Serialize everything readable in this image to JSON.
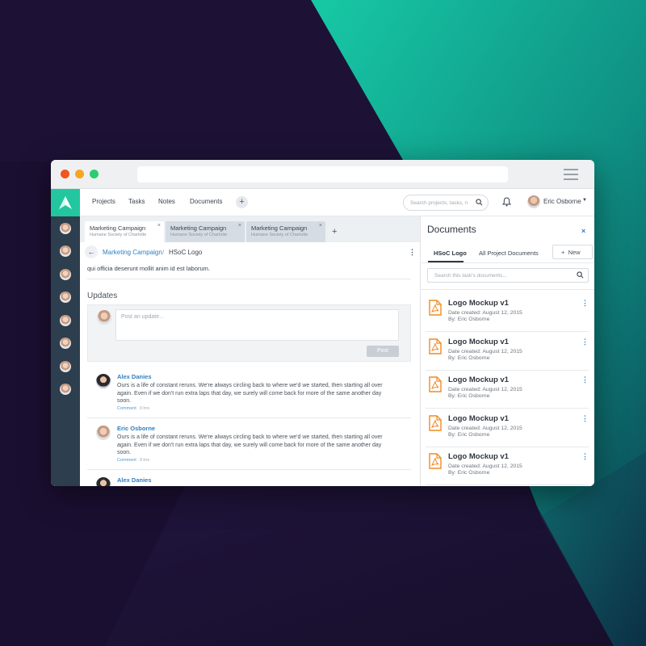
{
  "colors": {
    "accent_teal": "#22c7a0",
    "link_blue": "#2f7fc1",
    "pdf_orange": "#f08a24",
    "sidebar_dark": "#2d3e4e",
    "background": "#1b0f31"
  },
  "nav": {
    "items": [
      "Projects",
      "Tasks",
      "Notes",
      "Documents"
    ],
    "add_icon": "+",
    "search_placeholder": "Search projects, tasks, n",
    "user_name": "Eric Osborne",
    "icons": [
      "logo-icon",
      "search-icon",
      "bell-icon",
      "chevron-down-icon"
    ]
  },
  "tabs": [
    {
      "title": "Marketing Campaign",
      "subtitle": "Humane Society of Charlotte",
      "close": "×",
      "active": true
    },
    {
      "title": "Marketing Campaign",
      "subtitle": "Humane Society of Charlotte",
      "close": "×",
      "active": false
    },
    {
      "title": "Marketing Campaign",
      "subtitle": "Humane Society of Charlotte",
      "close": "×",
      "active": false
    }
  ],
  "tab_add": "+",
  "breadcrumb": {
    "back": "←",
    "parent": "Marketing Campaign",
    "separator": "/",
    "current": "HSoC Logo",
    "menu": "⋮"
  },
  "main": {
    "lorem_tail": "qui officia deserunt mollit anim id est laborum.",
    "updates_heading": "Updates",
    "post_placeholder": "Post an update...",
    "post_button": "Post",
    "updates": [
      {
        "author": "Alex Danies",
        "text": "Ours is a life of constant reruns. We're always circling back to where we'd we started, then starting all over again. Even if we don't run extra laps that day, we surely will come back for more of the same another day soon.",
        "comment": "Comment",
        "time": "9 hrs"
      },
      {
        "author": "Eric Osborne",
        "text": "Ours is a life of constant reruns. We're always circling back to where we'd we started, then starting all over again. Even if we don't run extra laps that day, we surely will come back for more of the same another day soon.",
        "comment": "Comment",
        "time": "9 hrs"
      },
      {
        "author": "Alex Danies",
        "text": "",
        "comment": "",
        "time": ""
      }
    ]
  },
  "documents": {
    "title": "Documents",
    "close": "×",
    "tabs": [
      "HSoC Logo",
      "All Project Documents"
    ],
    "new_button": "New",
    "new_icon": "+",
    "search_placeholder": "Search this task's documents...",
    "items": [
      {
        "name": "Logo Mockup v1",
        "date": "Date created: August 12, 2015",
        "by": "By: Eric Osborne"
      },
      {
        "name": "Logo Mockup v1",
        "date": "Date created: August 12, 2015",
        "by": "By: Eric Osborne"
      },
      {
        "name": "Logo Mockup v1",
        "date": "Date created: August 12, 2015",
        "by": "By: Eric Osborne"
      },
      {
        "name": "Logo Mockup v1",
        "date": "Date created: August 12, 2015",
        "by": "By: Eric Osborne"
      },
      {
        "name": "Logo Mockup v1",
        "date": "Date created: August 12, 2015",
        "by": "By: Eric Osborne"
      }
    ],
    "item_menu": "⋮"
  }
}
